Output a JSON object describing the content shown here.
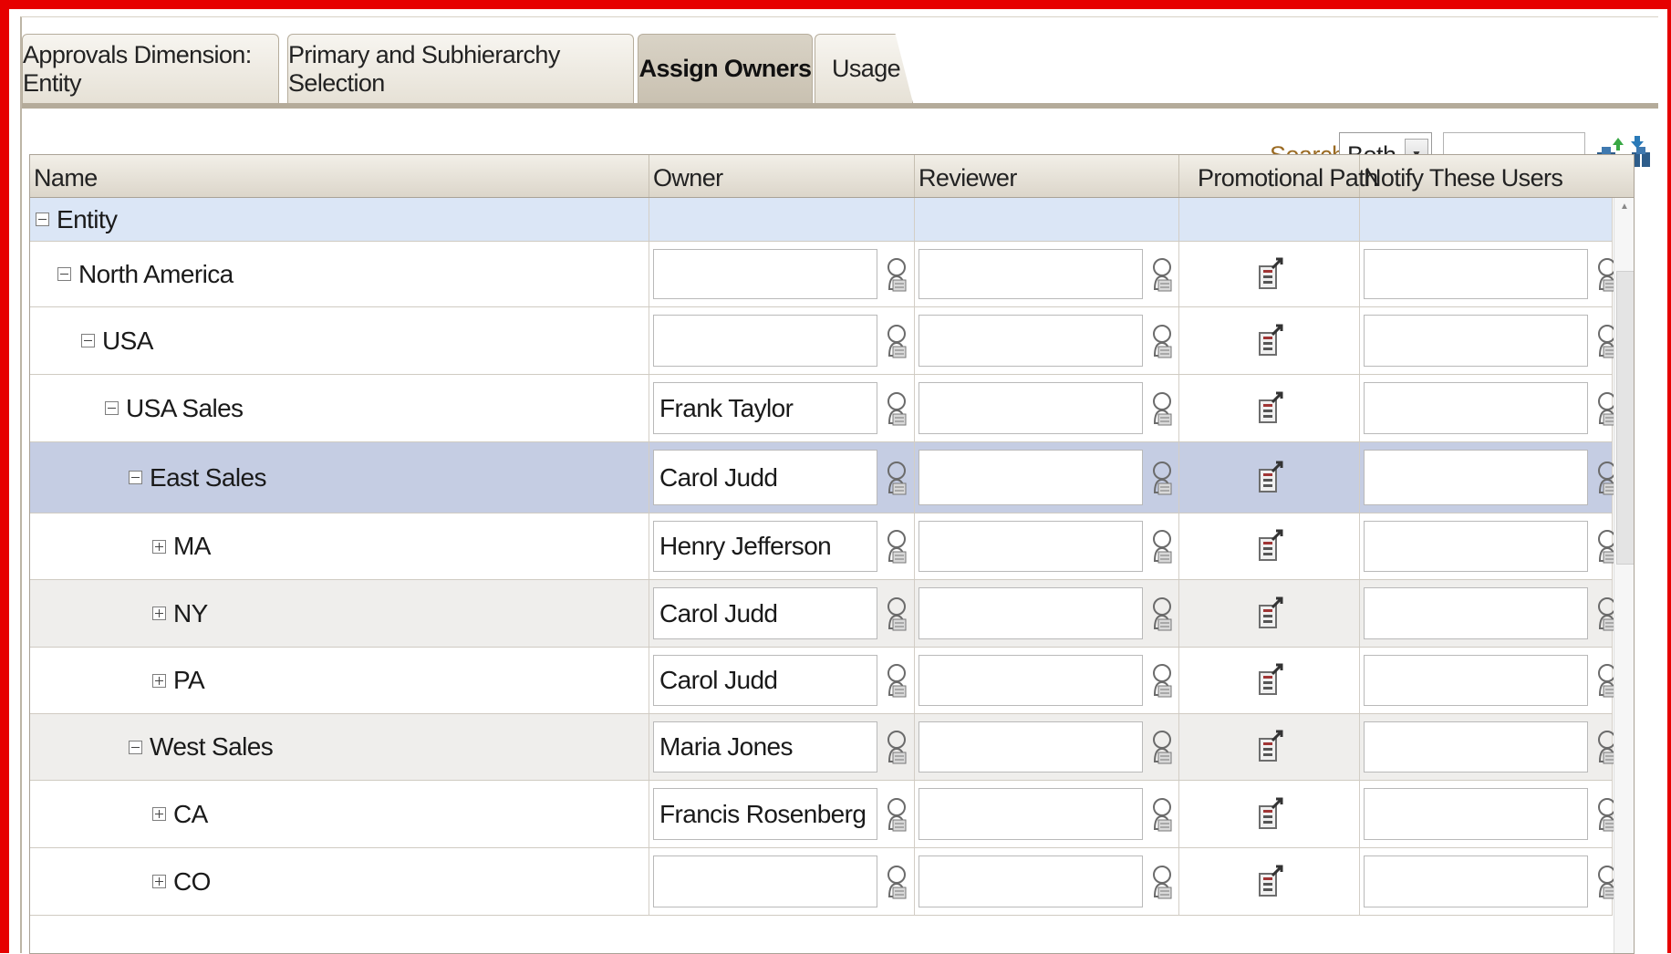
{
  "tabs": [
    {
      "label": "Approvals Dimension: Entity",
      "active": false
    },
    {
      "label": "Primary and Subhierarchy Selection",
      "active": false
    },
    {
      "label": "Assign Owners",
      "active": true
    },
    {
      "label": "Usage",
      "active": false
    }
  ],
  "search": {
    "label": "Search",
    "scope_value": "Both",
    "query": "",
    "icons": [
      "search-up-icon",
      "search-down-icon"
    ]
  },
  "columns": {
    "name": "Name",
    "owner": "Owner",
    "reviewer": "Reviewer",
    "promotional_path": "Promotional Path",
    "notify": "Notify These Users"
  },
  "rows": [
    {
      "name": "Entity",
      "level": 0,
      "expander": "minus",
      "owner": null,
      "reviewer": null,
      "notify": null,
      "state": "root"
    },
    {
      "name": "North America",
      "level": 1,
      "expander": "minus",
      "owner": "",
      "reviewer": "",
      "notify": "",
      "state": ""
    },
    {
      "name": "USA",
      "level": 2,
      "expander": "minus",
      "owner": "",
      "reviewer": "",
      "notify": "",
      "state": ""
    },
    {
      "name": "USA Sales",
      "level": 3,
      "expander": "minus",
      "owner": "Frank Taylor",
      "reviewer": "",
      "notify": "",
      "state": ""
    },
    {
      "name": "East Sales",
      "level": 4,
      "expander": "minus",
      "owner": "Carol Judd",
      "reviewer": "",
      "notify": "",
      "state": "selected"
    },
    {
      "name": "MA",
      "level": 5,
      "expander": "plus",
      "owner": "Henry Jefferson",
      "reviewer": "",
      "notify": "",
      "state": ""
    },
    {
      "name": "NY",
      "level": 5,
      "expander": "plus",
      "owner": "Carol Judd",
      "reviewer": "",
      "notify": "",
      "state": "shaded"
    },
    {
      "name": "PA",
      "level": 5,
      "expander": "plus",
      "owner": "Carol Judd",
      "reviewer": "",
      "notify": "",
      "state": ""
    },
    {
      "name": "West Sales",
      "level": 4,
      "expander": "minus",
      "owner": "Maria Jones",
      "reviewer": "",
      "notify": "",
      "state": "shaded"
    },
    {
      "name": "CA",
      "level": 5,
      "expander": "plus",
      "owner": "Francis Rosenberg",
      "reviewer": "",
      "notify": "",
      "state": ""
    },
    {
      "name": "CO",
      "level": 5,
      "expander": "plus",
      "owner": "",
      "reviewer": "",
      "notify": "",
      "state": ""
    }
  ],
  "icons": {
    "lookup": "user-lookup-icon",
    "promotional_path": "promotional-path-icon",
    "expand": "tree-expand-icon",
    "collapse": "tree-collapse-icon"
  },
  "colors": {
    "frame": "#e60000",
    "selected_row": "#c5cde3",
    "root_row": "#dbe6f6",
    "search_label": "#9a6a22"
  }
}
